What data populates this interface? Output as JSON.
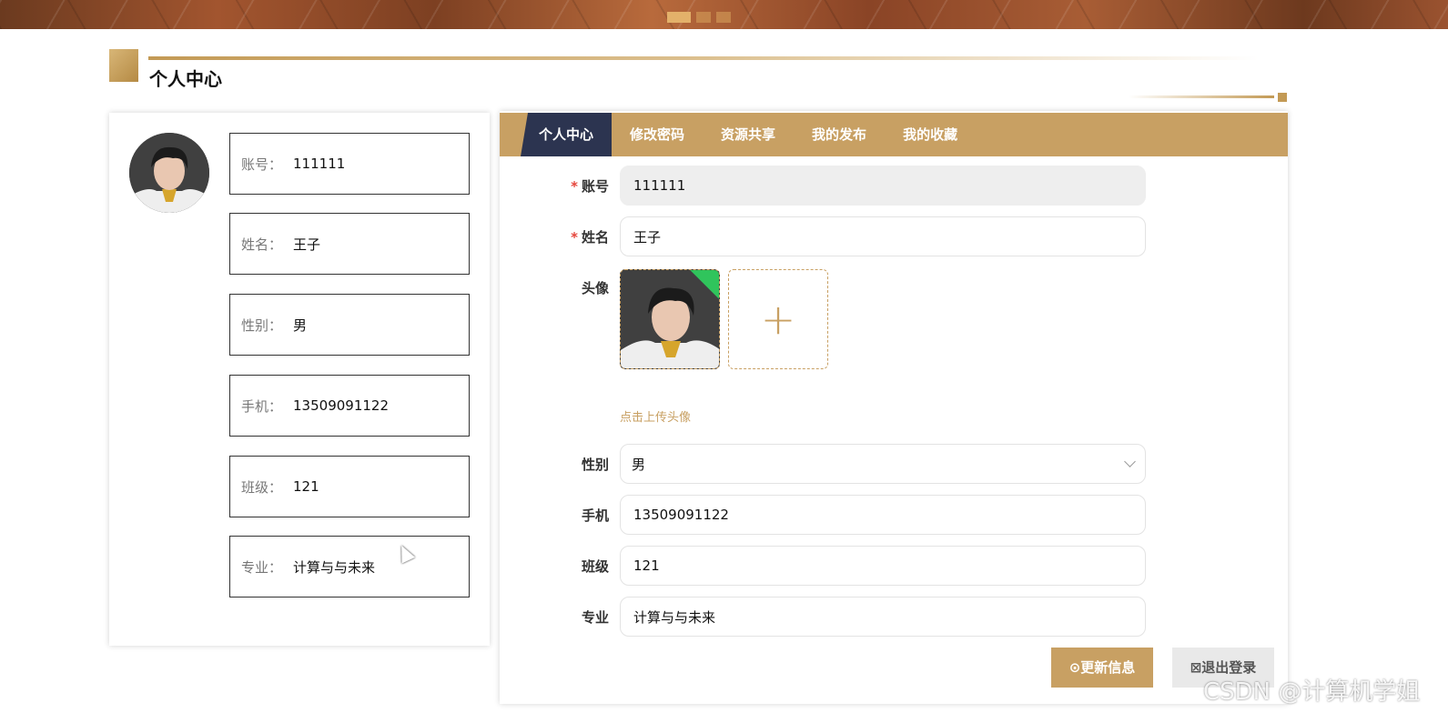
{
  "banner": {
    "slides": 3,
    "active_slide": 1
  },
  "section": {
    "title": "个人中心"
  },
  "profile_card": {
    "items": [
      {
        "label": "账号：",
        "value": "111111"
      },
      {
        "label": "姓名：",
        "value": "王子"
      },
      {
        "label": "性别：",
        "value": "男"
      },
      {
        "label": "手机：",
        "value": "13509091122"
      },
      {
        "label": "班级：",
        "value": "121"
      },
      {
        "label": "专业：",
        "value": "计算与与未来"
      }
    ]
  },
  "tabs": [
    {
      "label": "个人中心",
      "active": true
    },
    {
      "label": "修改密码",
      "active": false
    },
    {
      "label": "资源共享",
      "active": false
    },
    {
      "label": "我的发布",
      "active": false
    },
    {
      "label": "我的收藏",
      "active": false
    }
  ],
  "form": {
    "account": {
      "label": "账号",
      "required_mark": "*",
      "value": "111111"
    },
    "name": {
      "label": "姓名",
      "required_mark": "*",
      "value": "王子"
    },
    "avatar": {
      "label": "头像",
      "add_symbol": "+",
      "tip": "点击上传头像",
      "check": "✓"
    },
    "gender": {
      "label": "性别",
      "value": "男"
    },
    "phone": {
      "label": "手机",
      "value": "13509091122"
    },
    "class": {
      "label": "班级",
      "value": "121"
    },
    "major": {
      "label": "专业",
      "value": "计算与与未来"
    }
  },
  "buttons": {
    "save": {
      "icon": "⊙",
      "label": "更新信息"
    },
    "logout": {
      "icon": "⊠",
      "label": "退出登录"
    }
  },
  "watermark": "CSDN @计算机学姐",
  "colors": {
    "accent": "#c8a063",
    "tab_active": "#2c3450",
    "required": "#e5453b",
    "success": "#30c45c"
  }
}
